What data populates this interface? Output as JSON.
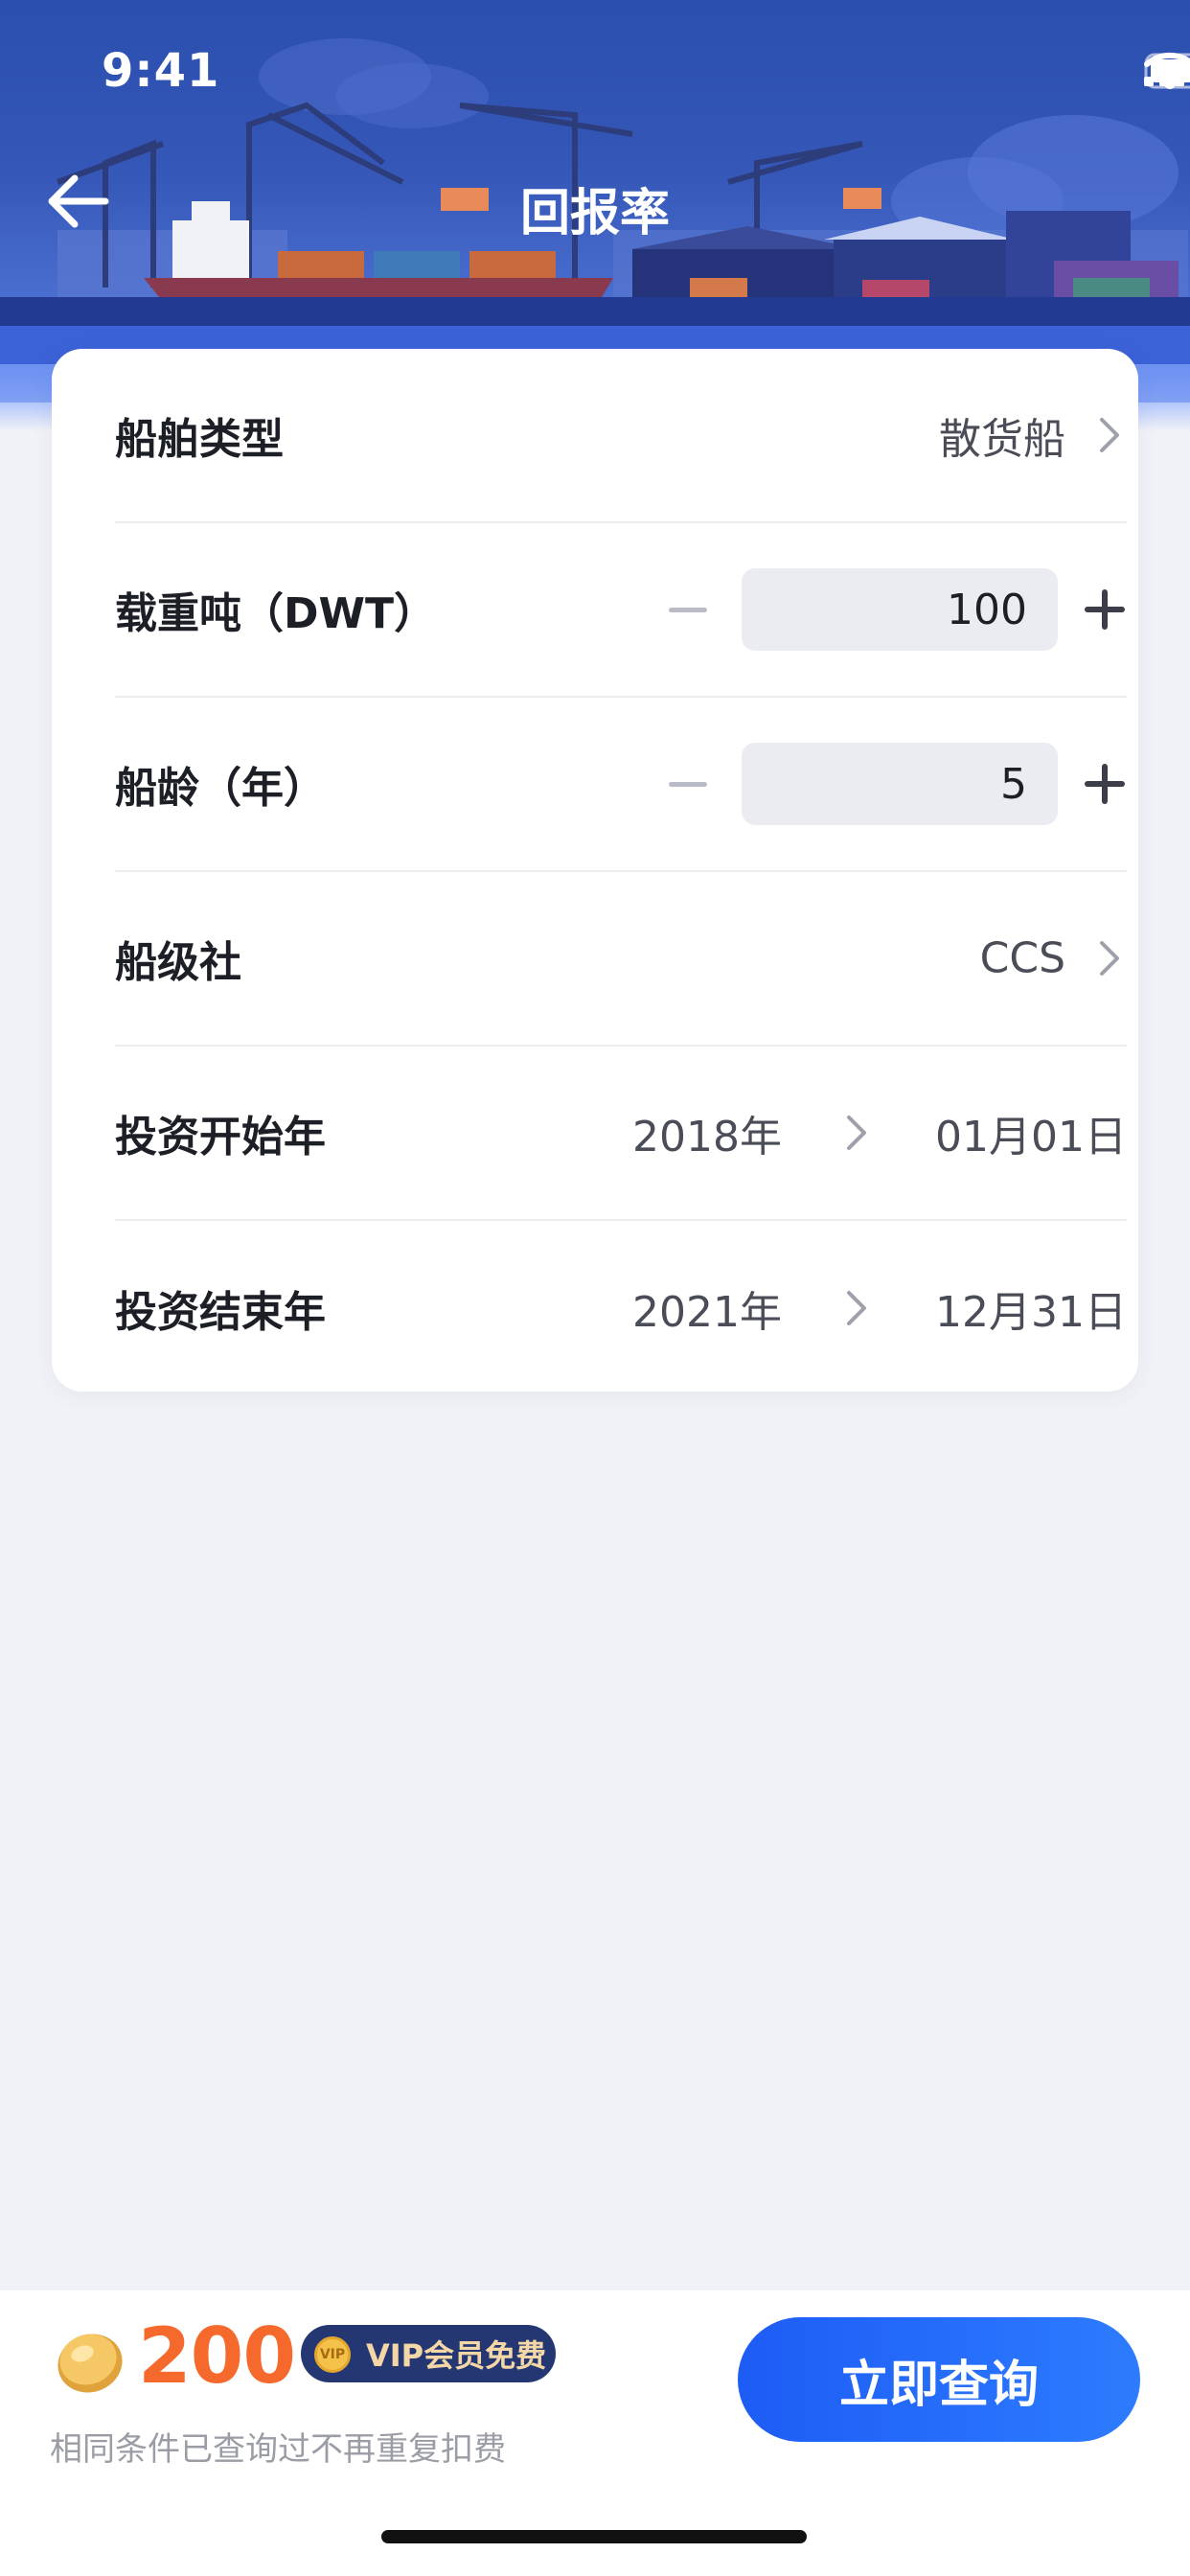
{
  "status_bar": {
    "time": "9:41"
  },
  "nav": {
    "title": "回报率"
  },
  "form": {
    "ship_type": {
      "label": "船舶类型",
      "value": "散货船"
    },
    "dwt": {
      "label": "载重吨（DWT）",
      "value": "100"
    },
    "ship_age": {
      "label": "船龄（年）",
      "value": "5"
    },
    "class_society": {
      "label": "船级社",
      "value": "CCS"
    },
    "invest_start": {
      "label": "投资开始年",
      "year": "2018年",
      "month_day": "01月01日"
    },
    "invest_end": {
      "label": "投资结束年",
      "year": "2021年",
      "month_day": "12月31日"
    }
  },
  "bottom": {
    "price": "200",
    "vip_badge": "VIP会员免费",
    "vip_coin_text": "VIP",
    "note": "相同条件已查询过不再重复扣费",
    "query_button": "立即查询"
  },
  "colors": {
    "accent": "#1d5cf5",
    "price": "#f56a2c",
    "header_blue": "#2a4fae",
    "vip_badge_bg": "#253773"
  },
  "icons": {
    "back": "back-arrow-icon",
    "chevron": "chevron-right-icon",
    "signal": "cellular-signal-icon",
    "wifi": "wifi-icon",
    "battery": "battery-icon",
    "coin": "gold-coin-icon"
  }
}
